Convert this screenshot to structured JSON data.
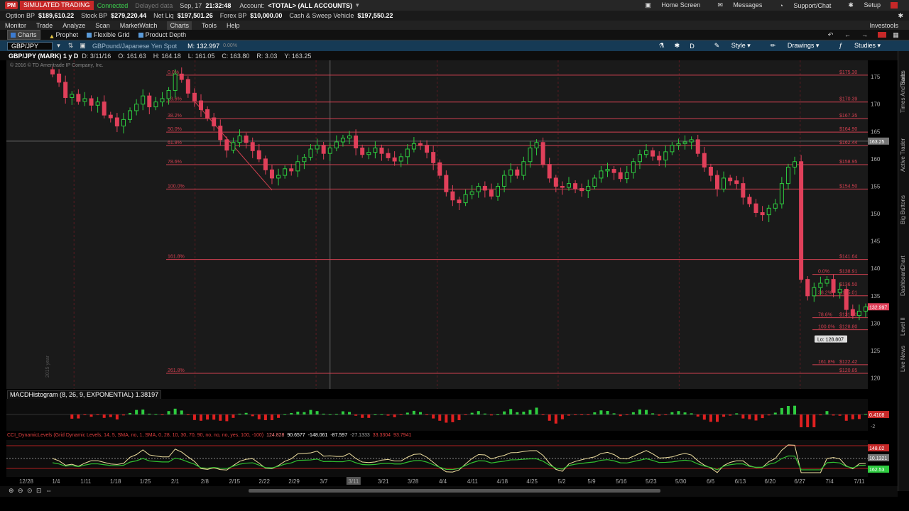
{
  "topbar": {
    "pm": "PM",
    "mode": "SIMULATED TRADING",
    "connected": "Connected",
    "delayed": "Delayed data",
    "date": "Sep, 17",
    "time": "21:32:48",
    "account_label": "Account:",
    "account_value": "<TOTAL> (ALL ACCOUNTS)",
    "home": "Home Screen",
    "messages": "Messages",
    "support": "Support/Chat",
    "setup": "Setup"
  },
  "acct": {
    "option_bp_label": "Option BP",
    "option_bp": "$189,610.22",
    "stock_bp_label": "Stock BP",
    "stock_bp": "$279,220.44",
    "net_liq_label": "Net Liq",
    "net_liq": "$197,501.26",
    "forex_bp_label": "Forex BP",
    "forex_bp": "$10,000.00",
    "cash_label": "Cash & Sweep Vehicle",
    "cash": "$197,550.22"
  },
  "menu": [
    "Monitor",
    "Trade",
    "Analyze",
    "Scan",
    "MarketWatch",
    "Charts",
    "Tools",
    "Help"
  ],
  "menu_active": "Charts",
  "investools": "Investools",
  "subtabs": [
    "Charts",
    "Prophet",
    "Flexible Grid",
    "Product Depth"
  ],
  "symbol": {
    "ticker": "GBP/JPY",
    "description": "GBPound/Japanese Yen Spot",
    "mark_label": "M:",
    "mark": "132.997",
    "change": "0.00%",
    "d_label": "D",
    "style": "Style",
    "drawings": "Drawings",
    "studies": "Studies"
  },
  "info": {
    "title": "GBP/JPY (MARK) 1 y D",
    "d": "D: 3/11/16",
    "o": "O: 161.63",
    "h": "H: 164.18",
    "l": "L: 161.05",
    "c": "C: 163.80",
    "r": "R: 3.03",
    "y": "Y: 163.25"
  },
  "copyright": "© 2016 © TD Ameritrade IP Company, Inc.",
  "year_marker": "2015 year",
  "chart_data": {
    "type": "candlestick",
    "ylim": [
      118,
      178
    ],
    "y_ticks": [
      175,
      170,
      165,
      160,
      155,
      150,
      145,
      140,
      135,
      130,
      125,
      120
    ],
    "x_ticks": [
      "12/28",
      "1/4",
      "1/11",
      "1/18",
      "1/25",
      "2/1",
      "2/8",
      "2/15",
      "2/22",
      "2/29",
      "3/7",
      "3/11",
      "3/21",
      "3/28",
      "4/4",
      "4/11",
      "4/18",
      "4/25",
      "5/2",
      "5/9",
      "5/16",
      "5/23",
      "5/30",
      "6/6",
      "6/13",
      "6/20",
      "6/27",
      "7/4",
      "7/11"
    ],
    "fib_main": [
      {
        "label": "0.0%",
        "price": 175.3
      },
      {
        "label": "23.6%",
        "price": 170.39
      },
      {
        "label": "38.2%",
        "price": 167.35
      },
      {
        "label": "50.0%",
        "price": 164.9
      },
      {
        "label": "61.8%",
        "price": 162.44
      },
      {
        "label": "78.6%",
        "price": 158.95
      },
      {
        "label": "100.0%",
        "price": 154.5
      },
      {
        "label": "161.8%",
        "price": 141.64
      },
      {
        "label": "261.8%",
        "price": 120.85
      }
    ],
    "fib_right": [
      {
        "label": "0.0%",
        "price": 138.91
      },
      {
        "label": "38.2%",
        "price": 135.01
      },
      {
        "label": "78.6%",
        "price": 131.0
      },
      {
        "label": "100.0%",
        "price": 128.8
      },
      {
        "label": "161.8%",
        "price": 122.42
      }
    ],
    "fib_right_extra": "136.50",
    "low_label": "Lo: 128.807",
    "last_price": "132.997",
    "closes": [
      175.5,
      174.0,
      171.2,
      171.8,
      170.5,
      171.0,
      169.8,
      170.4,
      168.0,
      167.5,
      166.0,
      167.2,
      168.8,
      170.0,
      171.5,
      169.5,
      170.4,
      171.0,
      172.5,
      175.5,
      174.5,
      172.0,
      170.6,
      169.0,
      167.5,
      166.0,
      163.5,
      161.6,
      163.0,
      164.2,
      163.0,
      161.5,
      160.0,
      158.0,
      156.5,
      157.0,
      158.2,
      157.8,
      159.5,
      160.3,
      161.8,
      162.5,
      161.0,
      162.0,
      163.1,
      163.8,
      164.2,
      162.0,
      160.8,
      161.2,
      162.0,
      161.0,
      160.2,
      159.6,
      160.4,
      161.8,
      162.8,
      162.5,
      161.2,
      159.3,
      157.0,
      154.0,
      152.5,
      152.0,
      153.5,
      154.0,
      155.0,
      154.3,
      153.2,
      155.0,
      157.0,
      158.0,
      157.0,
      159.5,
      162.0,
      163.0,
      159.0,
      156.5,
      155.0,
      154.8,
      155.5,
      154.6,
      154.2,
      155.0,
      156.5,
      157.8,
      158.1,
      157.5,
      156.4,
      157.5,
      159.5,
      160.8,
      161.5,
      160.5,
      159.8,
      161.3,
      162.5,
      162.8,
      163.1,
      163.5,
      161.0,
      158.5,
      157.0,
      154.5,
      156.5,
      156.0,
      155.5,
      153.0,
      151.8,
      150.2,
      149.8,
      151.0,
      151.8,
      155.5,
      158.5,
      159.5,
      138.0,
      135.0,
      136.5,
      137.3,
      138.0,
      135.6,
      136.2,
      132.5,
      131.4,
      132.2,
      133.0
    ],
    "macd_label": "MACDHistogram (8, 26, 9, EXPONENTIAL)",
    "macd_value": "1.38197",
    "macd_axis": [
      "0.4108",
      "-2"
    ],
    "cci_label": "CCI_DynamicLevels (Grid Dynamic Levels, 14, 5, SMA, no, 1, SMA, 0, 28, 10, 30, 70, 90, no, no, no, yes, 100, -100)",
    "cci_values": [
      "124.828",
      "90.6577",
      "-148.061",
      "-87.597",
      "-27.1333",
      "33.3304",
      "93.7941"
    ],
    "cci_axis": [
      "148.02",
      "10.1321",
      "162.53"
    ]
  },
  "sidebar": [
    "Trade",
    "Times And Sales",
    "Active Trader",
    "Big Buttons",
    "Chart",
    "Dashboard",
    "Level II",
    "Live News"
  ],
  "colors": {
    "up": "#2ecc40",
    "down": "#e0405a",
    "fib": "#d04050",
    "bg": "#1a1a1a"
  }
}
